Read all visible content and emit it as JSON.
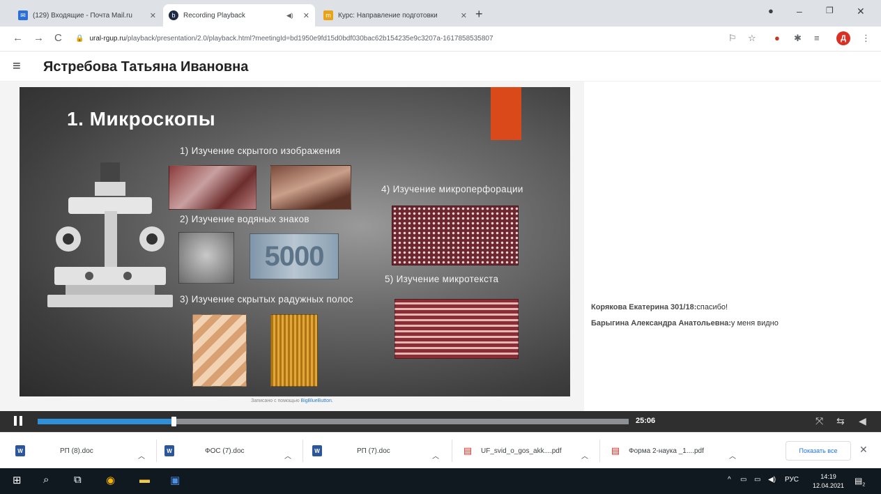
{
  "browser": {
    "tabs": [
      {
        "title": "(129) Входящие - Почта Mail.ru",
        "active": false
      },
      {
        "title": "Recording Playback",
        "active": true
      },
      {
        "title": "Курс: Направление подготовки",
        "active": false
      }
    ],
    "url_host": "ural-rgup.ru",
    "url_path": "/playback/presentation/2.0/playback.html?meetingId=bd1950e9fd15d0bdf030bac62b154235e9c3207a-1617858535807",
    "profile_initial": "Д"
  },
  "page": {
    "presenter_name": "Ястребова Татьяна Ивановна"
  },
  "slide": {
    "title": "1. Микроскопы",
    "items": [
      "1) Изучение скрытого изображения",
      "2) Изучение водяных знаков",
      "3) Изучение скрытых радужных полос",
      "4) Изучение микроперфорации",
      "5) Изучение микротекста"
    ],
    "watermark_number": "5000",
    "recorded_with": "Записано с помощью",
    "recorded_tool": "BigBlueButton."
  },
  "chat": {
    "messages": [
      {
        "author": "Корякова Екатерина 301/18:",
        "text": "спасибо!"
      },
      {
        "author": "Барыгина Александра Анатольевна:",
        "text": "у меня видно"
      }
    ]
  },
  "player": {
    "duration": "25:06",
    "progress_fraction": 0.23
  },
  "downloads": {
    "items": [
      {
        "name": "РП (8).doc",
        "type": "doc"
      },
      {
        "name": "ФОС (7).doc",
        "type": "doc"
      },
      {
        "name": "РП (7).doc",
        "type": "doc"
      },
      {
        "name": "UF_svid_o_gos_akk....pdf",
        "type": "pdf"
      },
      {
        "name": "Форма 2-наука _1....pdf",
        "type": "pdf"
      }
    ],
    "show_all": "Показать все"
  },
  "taskbar": {
    "lang": "РУС",
    "time": "14:19",
    "date": "12.04.2021",
    "notifications": "2"
  },
  "colors": {
    "accent_orange": "#d9491a",
    "progress_blue": "#2f8fd8",
    "player_bg": "#2f2f2f"
  }
}
